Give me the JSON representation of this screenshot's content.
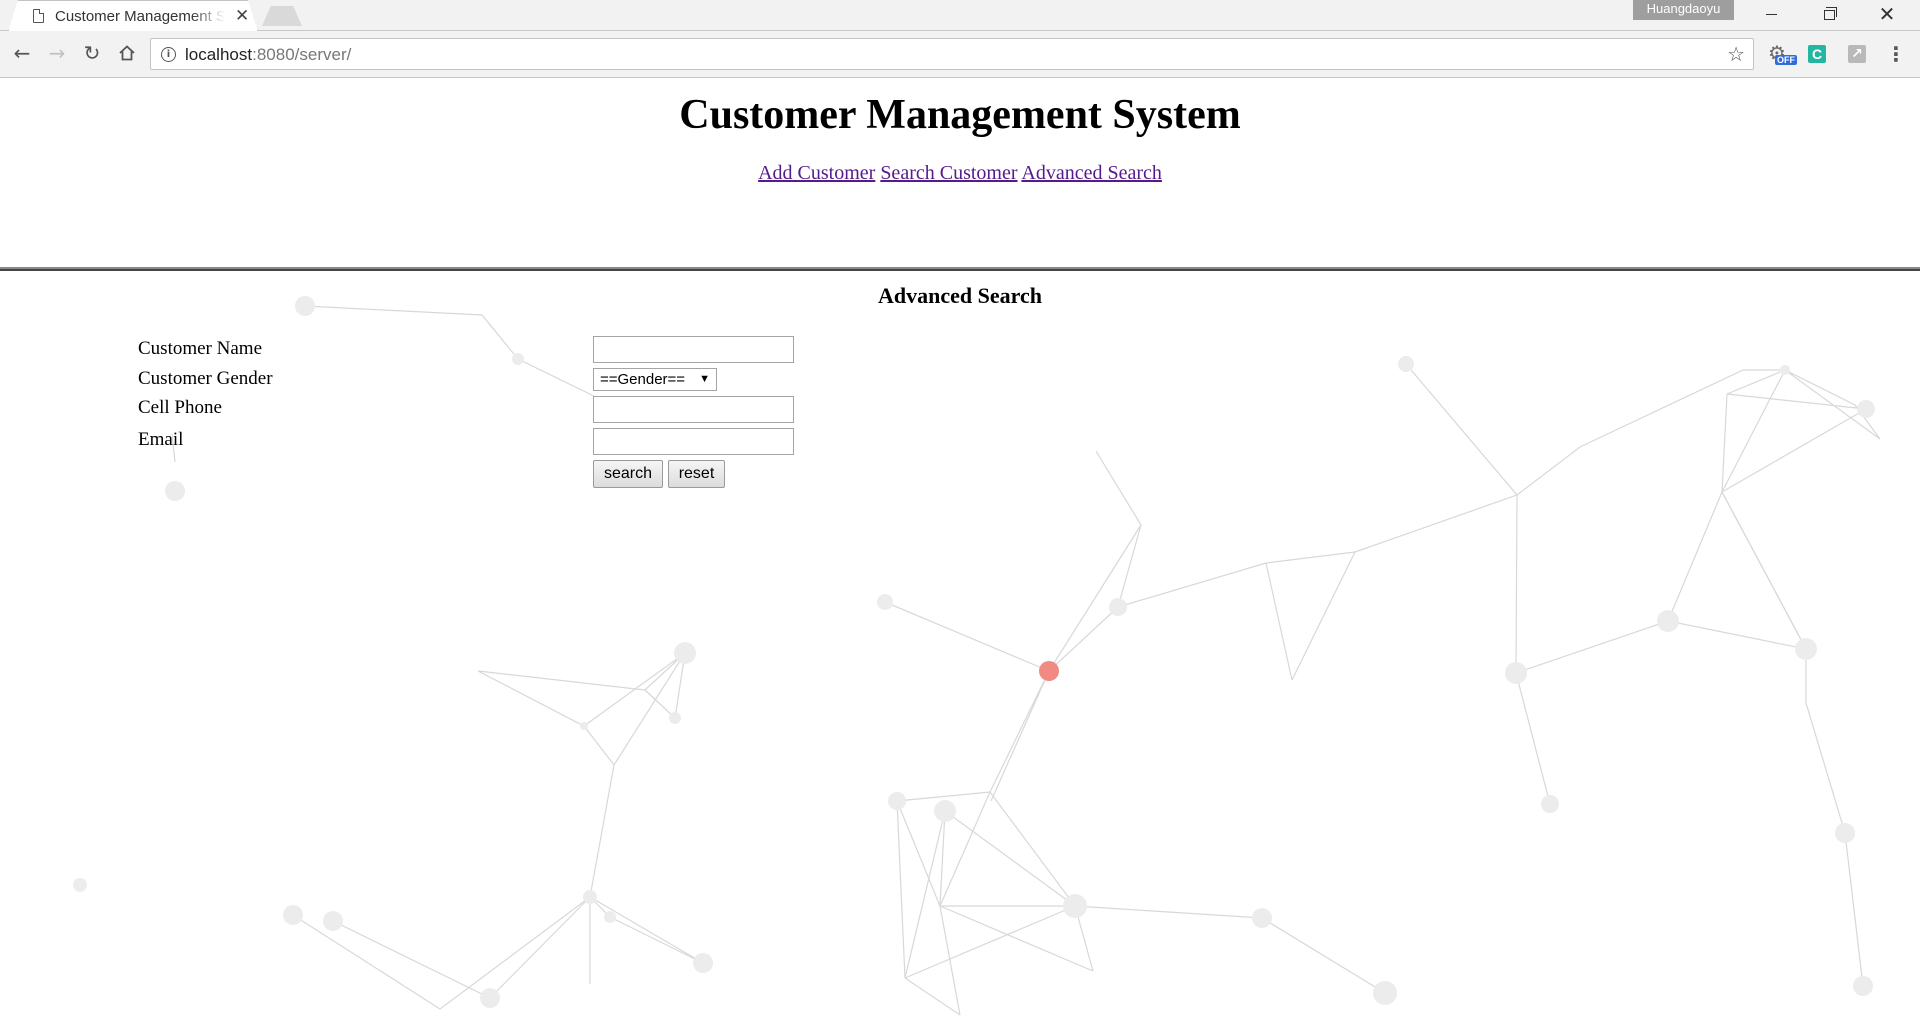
{
  "browser": {
    "tab_title": "Customer Management System",
    "tab_close": "✕",
    "profile_name": "Huangdaoyu",
    "url_host": "localhost",
    "url_rest": ":8080/server/",
    "ext_badge": "OFF",
    "ext_c_label": "C",
    "colors": {
      "ext_c": "#25b6a1",
      "ext_off_badge": "#2f6ed8",
      "chrome_bg": "#f2f2f2"
    }
  },
  "header": {
    "title": "Customer Management System",
    "nav": {
      "add_customer": "Add Customer",
      "search_customer": "Search Customer",
      "advanced_search": "Advanced Search"
    },
    "link_color": "#551a8b"
  },
  "search_form": {
    "title": "Advanced Search",
    "name_label": "Customer Name",
    "name_value": "",
    "gender_label": "Customer Gender",
    "gender_selected": "==Gender==",
    "phone_label": "Cell Phone",
    "phone_value": "",
    "email_label": "Email",
    "email_value": "",
    "search_label": "search",
    "reset_label": "reset"
  }
}
